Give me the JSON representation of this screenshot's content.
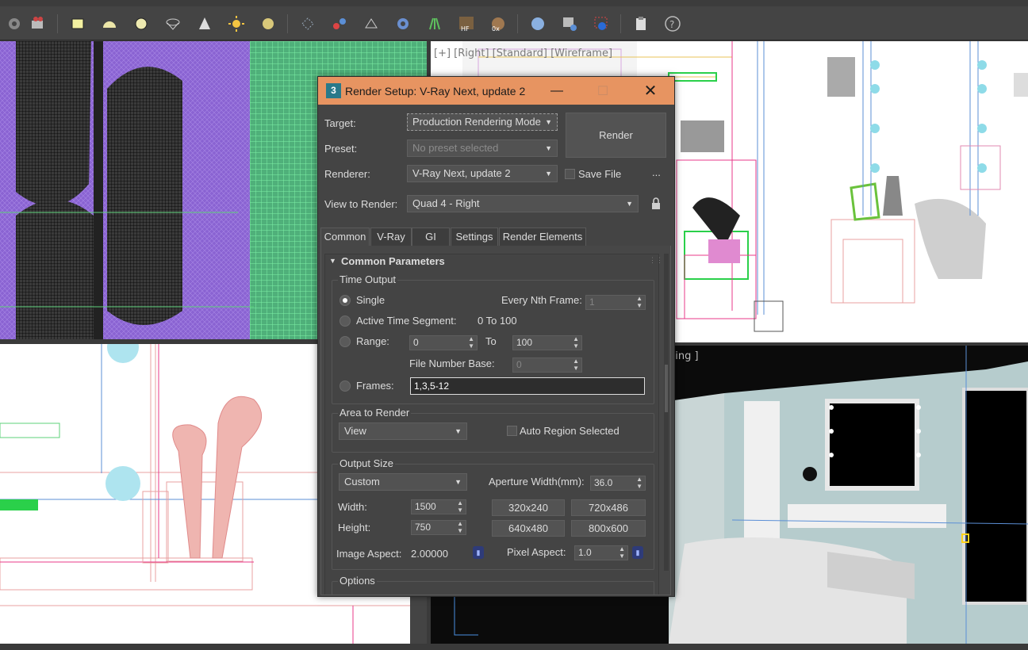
{
  "dialog": {
    "title": "Render Setup: V-Ray Next, update 2",
    "app_icon": "3",
    "target_label": "Target:",
    "target_value": "Production Rendering Mode",
    "preset_label": "Preset:",
    "preset_value": "No preset selected",
    "renderer_label": "Renderer:",
    "renderer_value": "V-Ray Next, update 2",
    "save_file_label": "Save File",
    "more_label": "...",
    "render_button": "Render",
    "view_label": "View to Render:",
    "view_value": "Quad 4 - Right",
    "tabs": [
      "Common",
      "V-Ray",
      "GI",
      "Settings",
      "Render Elements"
    ],
    "rollout_title": "Common Parameters",
    "time_output": {
      "title": "Time Output",
      "single": "Single",
      "every_nth_label": "Every Nth Frame:",
      "every_nth_value": "1",
      "active_segment": "Active Time Segment:",
      "active_segment_value": "0 To 100",
      "range": "Range:",
      "range_from": "0",
      "range_to_label": "To",
      "range_to": "100",
      "file_base_label": "File Number Base:",
      "file_base_value": "0",
      "frames": "Frames:",
      "frames_value": "1,3,5-12"
    },
    "area_to_render": {
      "title": "Area to Render",
      "value": "View",
      "auto_region": "Auto Region Selected"
    },
    "output_size": {
      "title": "Output Size",
      "preset": "Custom",
      "aperture_label": "Aperture Width(mm):",
      "aperture_value": "36.0",
      "width_label": "Width:",
      "width_value": "1500",
      "height_label": "Height:",
      "height_value": "750",
      "presets": [
        "320x240",
        "720x486",
        "640x480",
        "800x600"
      ],
      "image_aspect_label": "Image Aspect:",
      "image_aspect_value": "2.00000",
      "pixel_aspect_label": "Pixel Aspect:",
      "pixel_aspect_value": "1.0"
    },
    "options_title": "Options"
  },
  "viewports": {
    "top_right_label": "[+] [Right] [Standard] [Wireframe]",
    "bottom_right_label": "ding ]"
  },
  "colors": {
    "title_bar": "#e79461",
    "dialog_bg": "#444444",
    "wire_purple": "#8a63d2",
    "wire_green": "#58e08a",
    "wire_pink": "#e8a0a0",
    "accent_blue": "#5b8fd6"
  }
}
